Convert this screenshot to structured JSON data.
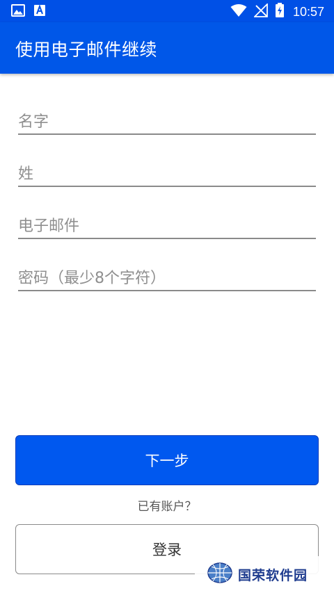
{
  "status_bar": {
    "time": "10:57",
    "icons": [
      "image-icon",
      "text-a-icon",
      "wifi-icon",
      "no-signal-icon",
      "battery-charging-icon"
    ]
  },
  "app_bar": {
    "title": "使用电子邮件继续"
  },
  "form": {
    "first_name_placeholder": "名字",
    "last_name_placeholder": "姓",
    "email_placeholder": "电子邮件",
    "password_placeholder": "密码（最少8个字符）"
  },
  "actions": {
    "next_label": "下一步",
    "have_account_text": "已有账户？",
    "login_label": "登录"
  },
  "watermark": {
    "text": "国荣软件园",
    "logo": "globe-logo-icon"
  },
  "colors": {
    "primary": "#0057e8",
    "button": "#0058ef",
    "divider": "#8a8a8a",
    "placeholder": "#8f8f8f"
  }
}
